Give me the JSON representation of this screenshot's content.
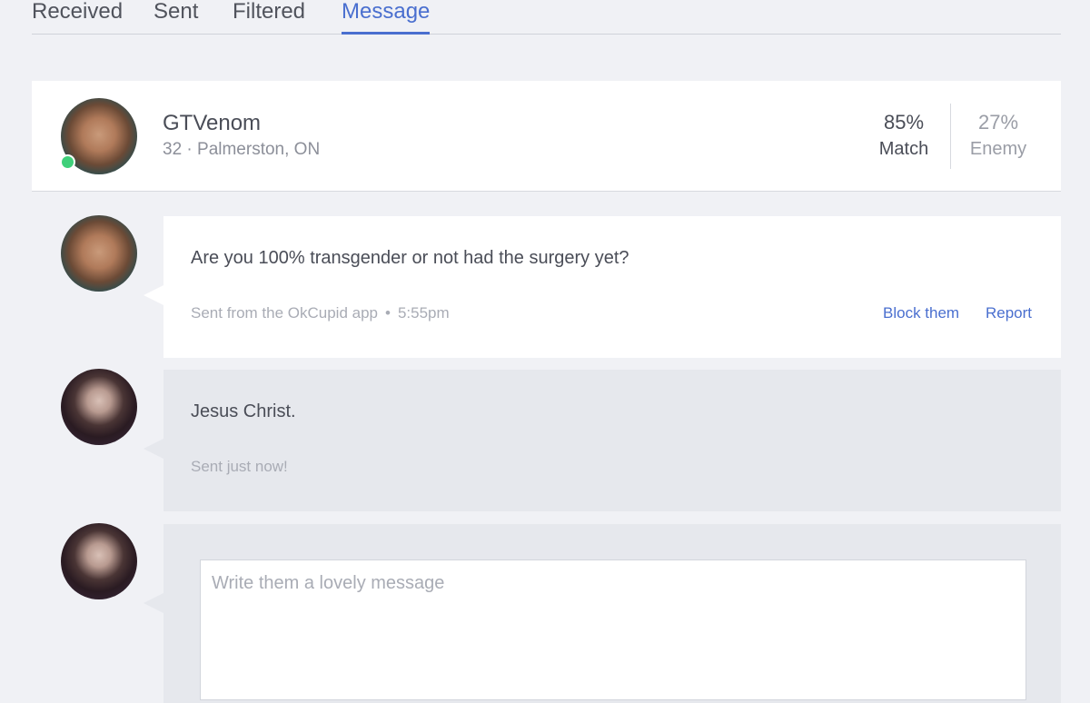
{
  "tabs": [
    {
      "label": "Received",
      "active": false
    },
    {
      "label": "Sent",
      "active": false
    },
    {
      "label": "Filtered",
      "active": false
    },
    {
      "label": "Message",
      "active": true
    }
  ],
  "profile": {
    "name": "GTVenom",
    "age": "32",
    "location": "Palmerston, ON",
    "meta": "32 · Palmerston, ON",
    "online": true,
    "match_value": "85%",
    "match_label": "Match",
    "enemy_value": "27%",
    "enemy_label": "Enemy"
  },
  "messages": [
    {
      "text": "Are you 100% transgender or not had the surgery yet?",
      "source": "Sent from the OkCupid app",
      "time": "5:55pm",
      "actions": {
        "block": "Block them",
        "report": "Report"
      }
    },
    {
      "text": "Jesus Christ.",
      "status": "Sent just now!"
    }
  ],
  "compose": {
    "placeholder": "Write them a lovely message"
  },
  "colors": {
    "accent": "#4a6fcf",
    "online": "#3fd07a",
    "background": "#f0f1f5"
  }
}
